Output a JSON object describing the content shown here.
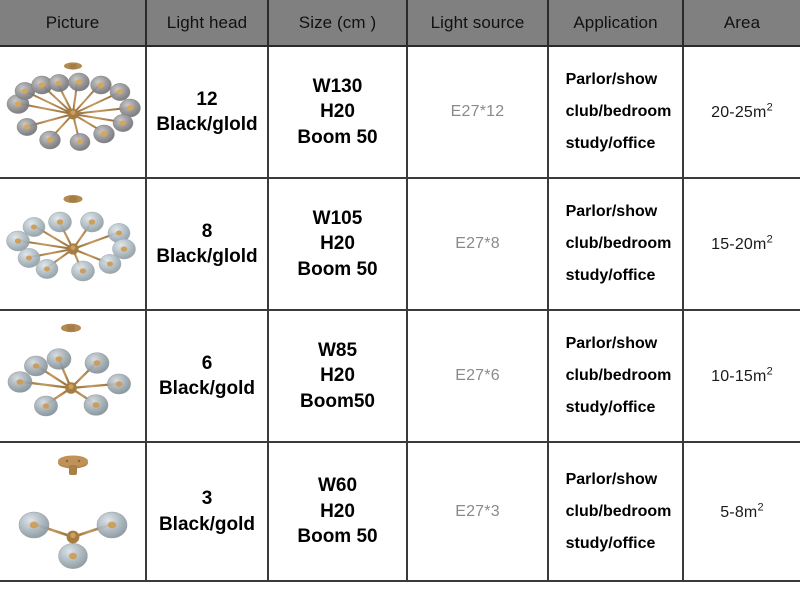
{
  "table": {
    "columns": [
      {
        "key": "picture",
        "label": "Picture"
      },
      {
        "key": "light_head",
        "label": "Light head"
      },
      {
        "key": "size",
        "label": "Size (cm )"
      },
      {
        "key": "light_source",
        "label": "Light source"
      },
      {
        "key": "application",
        "label": "Application"
      },
      {
        "key": "area",
        "label": "Area"
      }
    ],
    "rows": [
      {
        "picture_alt": "12-light gold sputnik chandelier with smoke glass globes",
        "lights": 12,
        "light_head_count": "12",
        "light_head_finish": "Black/glold",
        "size_w": "W130",
        "size_h": "H20",
        "size_boom": "Boom 50",
        "light_source": "E27*12",
        "application_line1": "Parlor/show",
        "application_line2": "club/bedroom",
        "application_line3": "study/office",
        "area": "20-25m",
        "area_sup": "2"
      },
      {
        "picture_alt": "8-light gold sputnik chandelier with smoke glass globes",
        "lights": 8,
        "light_head_count": "8",
        "light_head_finish": "Black/glold",
        "size_w": "W105",
        "size_h": "H20",
        "size_boom": "Boom 50",
        "light_source": "E27*8",
        "application_line1": "Parlor/show",
        "application_line2": "club/bedroom",
        "application_line3": "study/office",
        "area": "15-20m",
        "area_sup": "2"
      },
      {
        "picture_alt": "6-light gold sputnik chandelier with smoke glass globes",
        "lights": 6,
        "light_head_count": "6",
        "light_head_finish": "Black/gold",
        "size_w": "W85",
        "size_h": "H20",
        "size_boom": "Boom50",
        "light_source": "E27*6",
        "application_line1": "Parlor/show",
        "application_line2": "club/bedroom",
        "application_line3": "study/office",
        "area": "10-15m",
        "area_sup": "2"
      },
      {
        "picture_alt": "3-light gold chandelier with smoke glass globes",
        "lights": 3,
        "light_head_count": "3",
        "light_head_finish": "Black/gold",
        "size_w": "W60",
        "size_h": "H20",
        "size_boom": "Boom 50",
        "light_source": "E27*3",
        "application_line1": "Parlor/show",
        "application_line2": "club/bedroom",
        "application_line3": "study/office",
        "area": "5-8m",
        "area_sup": "2"
      }
    ]
  },
  "colors": {
    "header_background": "#808080",
    "header_text": "#111111",
    "grid_line": "#3a3a3a",
    "light_source_text": "#8a8a8a",
    "brass": "#b08a55",
    "brass_dark": "#8a6636",
    "glass_smoke": "#8e8e92",
    "glass_light": "#b9c4ca",
    "bulb_glow": "#d8a657"
  }
}
